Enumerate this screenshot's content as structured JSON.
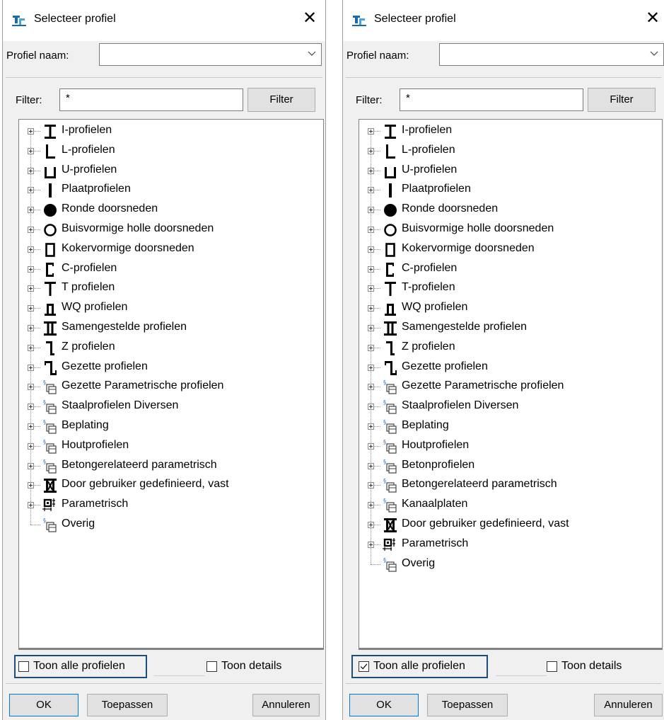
{
  "dialogs": [
    {
      "title": "Selecteer profiel",
      "profile_label": "Profiel naam:",
      "profile_value": "",
      "filter_label": "Filter:",
      "filter_value": "*",
      "filter_button": "Filter",
      "tree_items": [
        {
          "label": "I-profielen",
          "icon": "i-beam-icon"
        },
        {
          "label": "L-profielen",
          "icon": "l-angle-icon"
        },
        {
          "label": "U-profielen",
          "icon": "u-channel-icon"
        },
        {
          "label": "Plaatprofielen",
          "icon": "plate-icon"
        },
        {
          "label": "Ronde doorsneden",
          "icon": "solid-circle-icon"
        },
        {
          "label": "Buisvormige holle doorsneden",
          "icon": "hollow-circle-icon"
        },
        {
          "label": "Kokervormige doorsneden",
          "icon": "hollow-rect-icon"
        },
        {
          "label": "C-profielen",
          "icon": "c-channel-icon"
        },
        {
          "label": "T profielen",
          "icon": "t-section-icon"
        },
        {
          "label": "WQ profielen",
          "icon": "wq-section-icon"
        },
        {
          "label": "Samengestelde profielen",
          "icon": "compound-icon"
        },
        {
          "label": "Z profielen",
          "icon": "z-section-icon"
        },
        {
          "label": "Gezette profielen",
          "icon": "cold-formed-icon"
        },
        {
          "label": "Gezette Parametrische profielen",
          "icon": "parametric-library-icon"
        },
        {
          "label": "Staalprofielen Diversen",
          "icon": "parametric-library-icon"
        },
        {
          "label": "Beplating",
          "icon": "parametric-library-icon"
        },
        {
          "label": "Houtprofielen",
          "icon": "parametric-library-icon"
        },
        {
          "label": "Betongerelateerd parametrisch",
          "icon": "parametric-library-icon"
        },
        {
          "label": "Door gebruiker gedefinieerd, vast",
          "icon": "user-defined-icon"
        },
        {
          "label": "Parametrisch",
          "icon": "parametric-icon"
        },
        {
          "label": "Overig",
          "icon": "parametric-library-icon",
          "leaf": true
        }
      ],
      "show_all_label": "Toon alle profielen",
      "show_all_checked": false,
      "show_details_label": "Toon details",
      "show_details_checked": false,
      "ok_label": "OK",
      "apply_label": "Toepassen",
      "cancel_label": "Annuleren"
    },
    {
      "title": "Selecteer profiel",
      "profile_label": "Profiel naam:",
      "profile_value": "",
      "filter_label": "Filter:",
      "filter_value": "*",
      "filter_button": "Filter",
      "tree_items": [
        {
          "label": "I-profielen",
          "icon": "i-beam-icon"
        },
        {
          "label": "L-profielen",
          "icon": "l-angle-icon"
        },
        {
          "label": "U-profielen",
          "icon": "u-channel-icon"
        },
        {
          "label": "Plaatprofielen",
          "icon": "plate-icon"
        },
        {
          "label": "Ronde doorsneden",
          "icon": "solid-circle-icon"
        },
        {
          "label": "Buisvormige holle doorsneden",
          "icon": "hollow-circle-icon"
        },
        {
          "label": "Kokervormige doorsneden",
          "icon": "hollow-rect-icon"
        },
        {
          "label": "C-profielen",
          "icon": "c-channel-icon"
        },
        {
          "label": "T-profielen",
          "icon": "t-section-icon"
        },
        {
          "label": "WQ profielen",
          "icon": "wq-section-icon"
        },
        {
          "label": "Samengestelde profielen",
          "icon": "compound-icon"
        },
        {
          "label": "Z profielen",
          "icon": "z-section-icon"
        },
        {
          "label": "Gezette profielen",
          "icon": "cold-formed-icon"
        },
        {
          "label": "Gezette Parametrische profielen",
          "icon": "parametric-library-icon"
        },
        {
          "label": "Staalprofielen Diversen",
          "icon": "parametric-library-icon"
        },
        {
          "label": "Beplating",
          "icon": "parametric-library-icon"
        },
        {
          "label": "Houtprofielen",
          "icon": "parametric-library-icon"
        },
        {
          "label": "Betonprofielen",
          "icon": "parametric-library-icon"
        },
        {
          "label": "Betongerelateerd parametrisch",
          "icon": "parametric-library-icon"
        },
        {
          "label": "Kanaalplaten",
          "icon": "parametric-library-icon"
        },
        {
          "label": "Door gebruiker gedefinieerd, vast",
          "icon": "user-defined-icon"
        },
        {
          "label": "Parametrisch",
          "icon": "parametric-icon"
        },
        {
          "label": "Overig",
          "icon": "parametric-library-icon",
          "leaf": true
        }
      ],
      "show_all_label": "Toon alle profielen",
      "show_all_checked": true,
      "show_details_label": "Toon details",
      "show_details_checked": false,
      "ok_label": "OK",
      "apply_label": "Toepassen",
      "cancel_label": "Annuleren"
    }
  ],
  "colors": {
    "highlight_border": "#1e4f7a",
    "dialog_bg": "#f0f0f0",
    "app_icon": "#1a6aa8"
  }
}
